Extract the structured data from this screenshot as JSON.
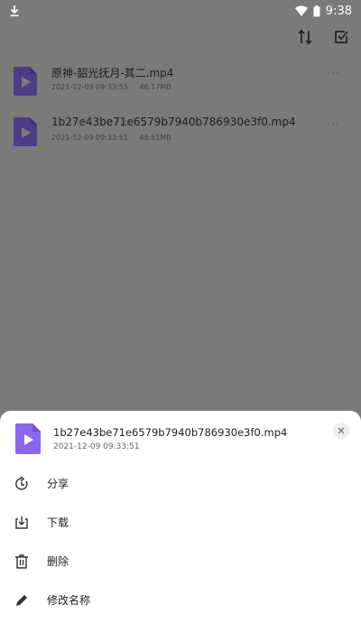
{
  "status_bar": {
    "time": "9:38",
    "left_icon": "download-icon",
    "right_icons": [
      "wifi-icon",
      "battery-icon"
    ]
  },
  "toolbar": {
    "icons": [
      "sort-icon",
      "select-icon"
    ]
  },
  "files": [
    {
      "name": "原神-韶光抚月-其二.mp4",
      "date": "2021-12-09 09:33:55",
      "size": "46.17MB"
    },
    {
      "name": "1b27e43be71e6579b7940b786930e3f0.mp4",
      "date": "2021-12-09 09:33:51",
      "size": "48.51MB"
    }
  ],
  "sheet": {
    "file_name": "1b27e43be71e6579b7940b786930e3f0.mp4",
    "file_date": "2021-12-09 09:33:51",
    "actions": [
      {
        "label": "分享",
        "icon": "share-icon"
      },
      {
        "label": "下载",
        "icon": "download-icon"
      },
      {
        "label": "删除",
        "icon": "trash-icon"
      },
      {
        "label": "修改名称",
        "icon": "pencil-icon"
      }
    ]
  },
  "colors": {
    "overlay": "#7a7a7a",
    "video_icon": "#4e3d86",
    "video_icon_sheet": "#8b66ee"
  }
}
